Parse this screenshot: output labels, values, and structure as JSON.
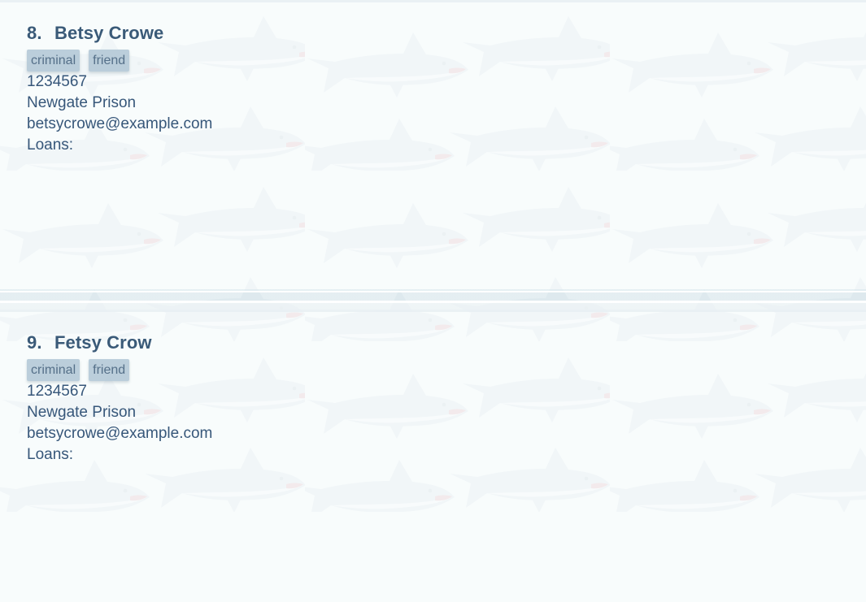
{
  "persons": [
    {
      "index": "8.",
      "name": "Betsy Crowe",
      "tags": [
        "criminal",
        "friend"
      ],
      "phone": "1234567",
      "address": "Newgate Prison",
      "email": "betsycrowe@example.com",
      "loans_label": "Loans:"
    },
    {
      "index": "9.",
      "name": "Fetsy Crow",
      "tags": [
        "criminal",
        "friend"
      ],
      "phone": "1234567",
      "address": "Newgate Prison",
      "email": "betsycrowe@example.com",
      "loans_label": "Loans:"
    }
  ],
  "theme": {
    "background": "#f5f9fa",
    "text": "#2e4d68",
    "tag_bg": "#b0c5d5",
    "shark_body": "#b7cad6",
    "shark_belly": "#eef4f6",
    "shark_mouth": "#c76b78"
  },
  "background_icon": "shark-pattern"
}
